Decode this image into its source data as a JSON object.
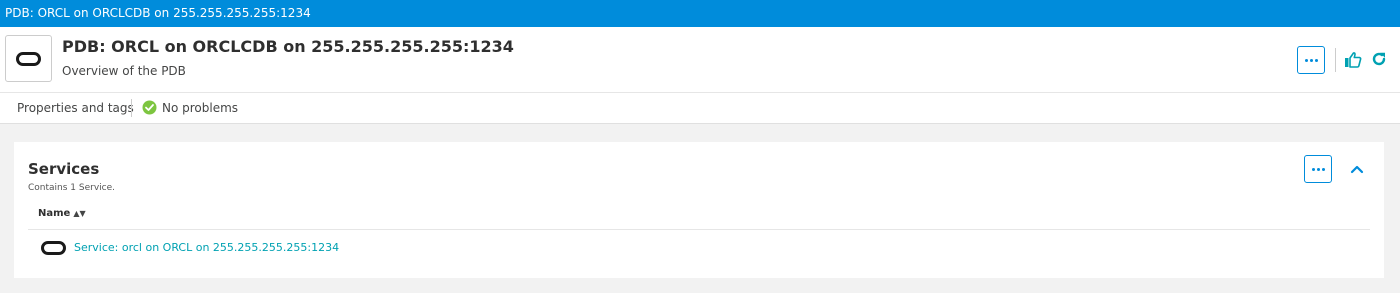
{
  "window": {
    "title": "PDB: ORCL on ORCLCDB on 255.255.255.255:1234"
  },
  "header": {
    "title": "PDB: ORCL on ORCLCDB on 255.255.255.255:1234",
    "subtitle": "Overview of the PDB",
    "logo_icon": "oracle-oval-icon",
    "actions": [
      "more-icon",
      "thumbs-up-icon",
      "refresh-icon"
    ]
  },
  "tabs": {
    "properties": "Properties and tags",
    "status": "No problems",
    "status_icon": "check-circle-icon"
  },
  "services": {
    "title": "Services",
    "subtitle": "Contains 1 Service.",
    "columns": [
      {
        "label": "Name",
        "icon": "sort-icon"
      }
    ],
    "rows": [
      {
        "icon": "oracle-oval-icon",
        "label": "Service: orcl on ORCL on 255.255.255.255:1234"
      }
    ]
  },
  "colors": {
    "topbar": "#008cdb",
    "accent": "#008cdb",
    "link": "#00a1b2",
    "success": "#7dc540"
  }
}
